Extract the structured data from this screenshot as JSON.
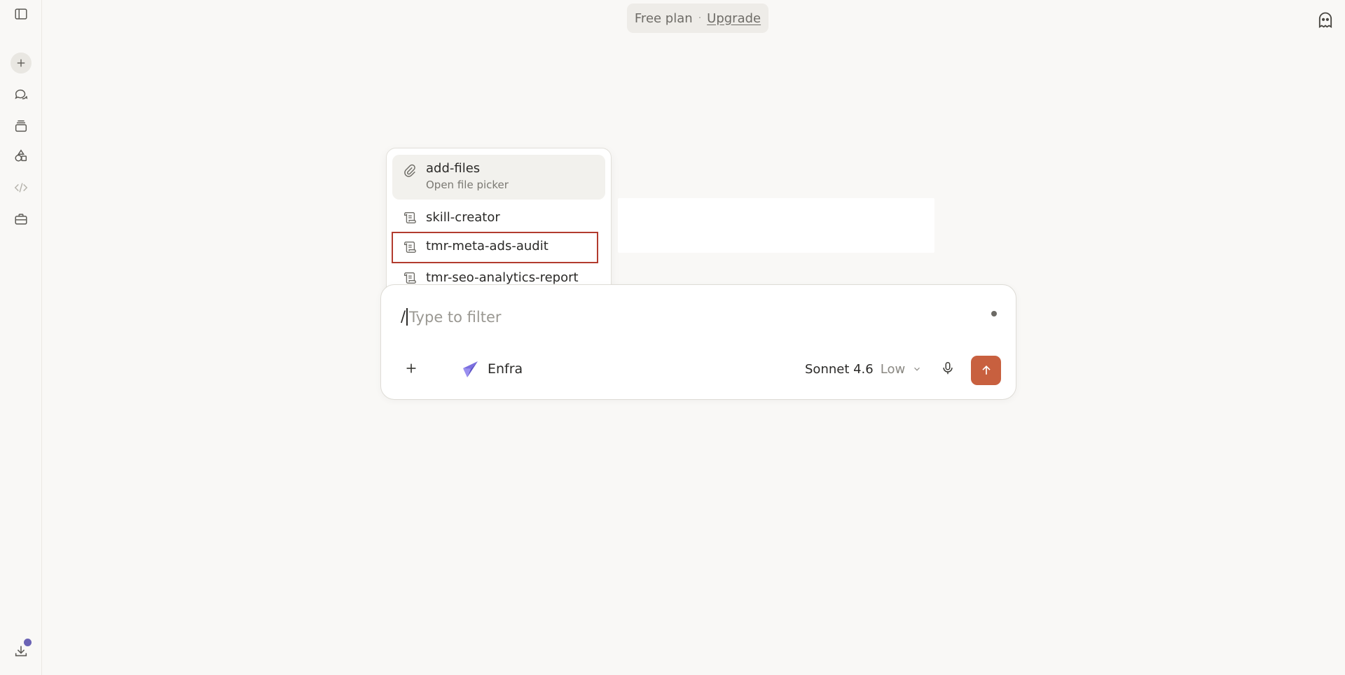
{
  "header": {
    "plan_label": "Free plan",
    "separator": "·",
    "upgrade_label": "Upgrade"
  },
  "sidebar": {
    "icons": [
      "sidebar-toggle-icon",
      "new-chat-icon",
      "chats-icon",
      "projects-icon",
      "artifacts-icon",
      "code-icon",
      "tools-icon",
      "download-icon"
    ]
  },
  "slash_menu": {
    "items": [
      {
        "title": "add-files",
        "subtitle": "Open file picker",
        "icon": "paperclip-icon"
      },
      {
        "title": "skill-creator",
        "icon": "scroll-icon"
      },
      {
        "title": "tmr-meta-ads-audit",
        "icon": "scroll-icon"
      },
      {
        "title": "tmr-seo-analytics-report",
        "icon": "scroll-icon"
      }
    ]
  },
  "composer": {
    "typed": "/",
    "placeholder": "Type to filter",
    "project_name": "Enfra",
    "model_name": "Sonnet 4.6",
    "effort": "Low"
  },
  "colors": {
    "accent": "#c8603f",
    "highlight_border": "#b23b2e",
    "project_logo": "#7b6fe0"
  }
}
